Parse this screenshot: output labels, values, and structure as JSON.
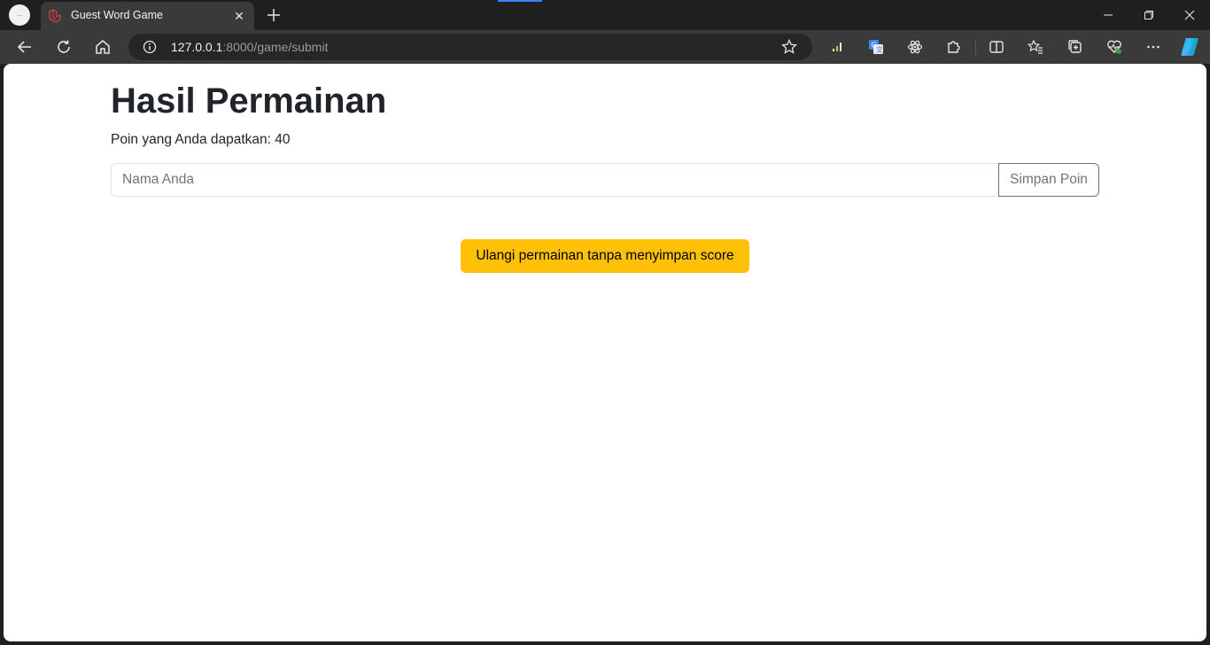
{
  "browser": {
    "tab": {
      "title": "Guest Word Game",
      "close": "✕"
    },
    "address": {
      "host": "127.0.0.1",
      "rest": ":8000/game/submit"
    },
    "profile_label": "··"
  },
  "page": {
    "heading": "Hasil Permainan",
    "points_text": "Poin yang Anda dapatkan: 40",
    "name_input": {
      "placeholder": "Nama Anda",
      "value": ""
    },
    "save_button": "Simpan Poin",
    "retry_button": "Ulangi permainan tanpa menyimpan score"
  },
  "colors": {
    "primary_text": "#212529",
    "warning": "#ffc107",
    "secondary": "#6c757d"
  },
  "icons": {
    "toolbar_left": [
      "back-arrow-icon",
      "refresh-icon",
      "home-icon"
    ],
    "toolbar_right": [
      "chart-icon",
      "translate-icon",
      "atom-icon",
      "extensions-icon",
      "split-screen-icon",
      "favorites-icon",
      "collections-icon",
      "health-icon",
      "more-icon",
      "copilot-icon"
    ]
  }
}
